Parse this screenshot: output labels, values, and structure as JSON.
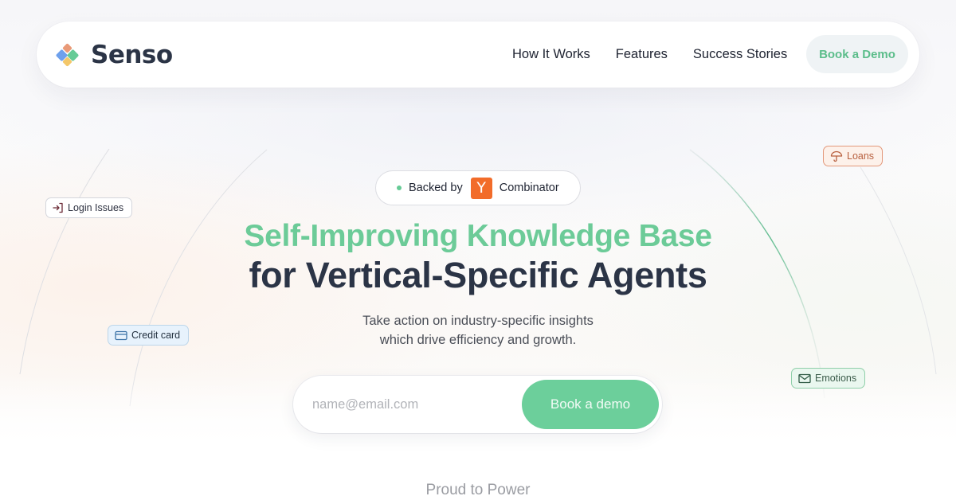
{
  "brand": {
    "name": "Senso",
    "logo_icon": "senso-diamond-logo",
    "colors": {
      "logo_top": "#e99a78",
      "logo_left": "#6ea0ec",
      "logo_right": "#66cb96",
      "logo_bottom": "#f3c76a",
      "accent_green": "#6ccf9b",
      "text_dark": "#2b3446",
      "yc_orange": "#f26c2a"
    }
  },
  "nav": {
    "links": [
      {
        "label": "How It Works"
      },
      {
        "label": "Features"
      },
      {
        "label": "Success Stories"
      }
    ],
    "cta_label": "Book a Demo"
  },
  "badge": {
    "prefix": "Backed by",
    "yc_letter": "Y",
    "suffix": "Combinator"
  },
  "hero": {
    "headline_line1": "Self-Improving Knowledge Base",
    "headline_line2": "for Vertical-Specific Agents",
    "subtitle_line1": "Take action on industry-specific insights",
    "subtitle_line2": "which drive efficiency and growth."
  },
  "email_form": {
    "placeholder": "name@email.com",
    "value": "",
    "submit_label": "Book a demo"
  },
  "tags": [
    {
      "label": "Login Issues",
      "icon": "login-arrow-icon"
    },
    {
      "label": "Credit card",
      "icon": "credit-card-icon"
    },
    {
      "label": "Loans",
      "icon": "umbrella-icon"
    },
    {
      "label": "Emotions",
      "icon": "mail-icon"
    }
  ],
  "footer_teaser": "Proud to Power"
}
